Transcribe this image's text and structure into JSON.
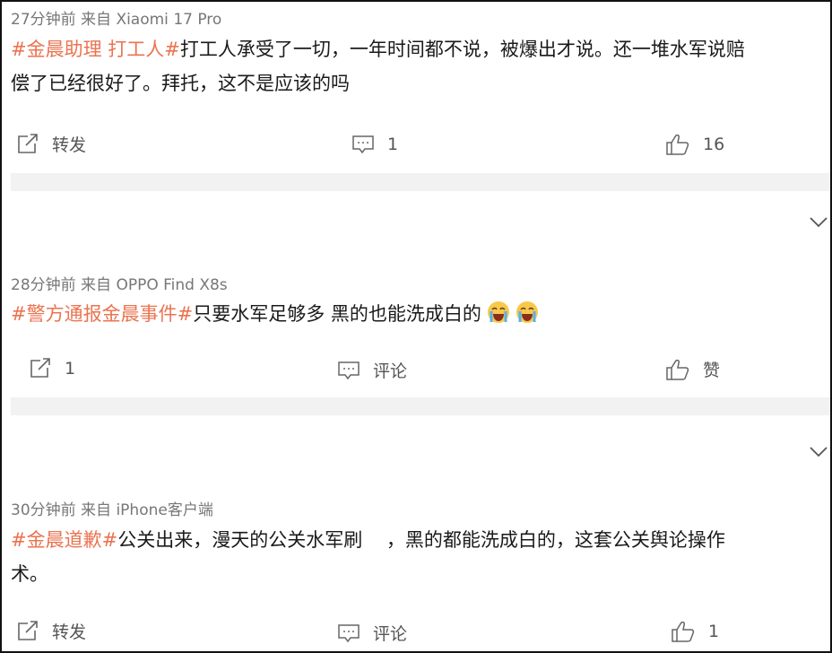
{
  "posts": [
    {
      "meta": "27分钟前  来自 Xiaomi 17 Pro",
      "tags": "#金晨助理 打工人#",
      "text_line1": "打工人承受了一切，一年时间都不说，被爆出才说。还一堆水军说赔",
      "text_line2": "偿了已经很好了。拜托，这不是应该的吗",
      "repost_label": "转发",
      "comment_label": "1",
      "like_label": "16"
    },
    {
      "meta": "28分钟前  来自 OPPO Find X8s",
      "tags": "#警方通报金晨事件#",
      "text_line1": "只要水军足够多 黑的也能洗成白的",
      "repost_label": "1",
      "comment_label": "评论",
      "like_label": "赞"
    },
    {
      "meta": "30分钟前  来自 iPhone客户端",
      "tags": "#金晨道歉#",
      "text_line1": "公关出来，漫天的公关水军刷    ，黑的都能洗成白的，这套公关舆论操作",
      "text_line2": "术。",
      "repost_label": "转发",
      "comment_label": "评论",
      "like_label": "1"
    }
  ],
  "icons": {
    "repost": "repost-icon",
    "comment": "comment-icon",
    "like": "thumbs-up-icon",
    "expand": "chevron-down-icon",
    "emoji": "crying-face-emoji"
  },
  "colors": {
    "tag": "#eb7350",
    "meta": "#777777",
    "separator": "#f2f2f2"
  }
}
